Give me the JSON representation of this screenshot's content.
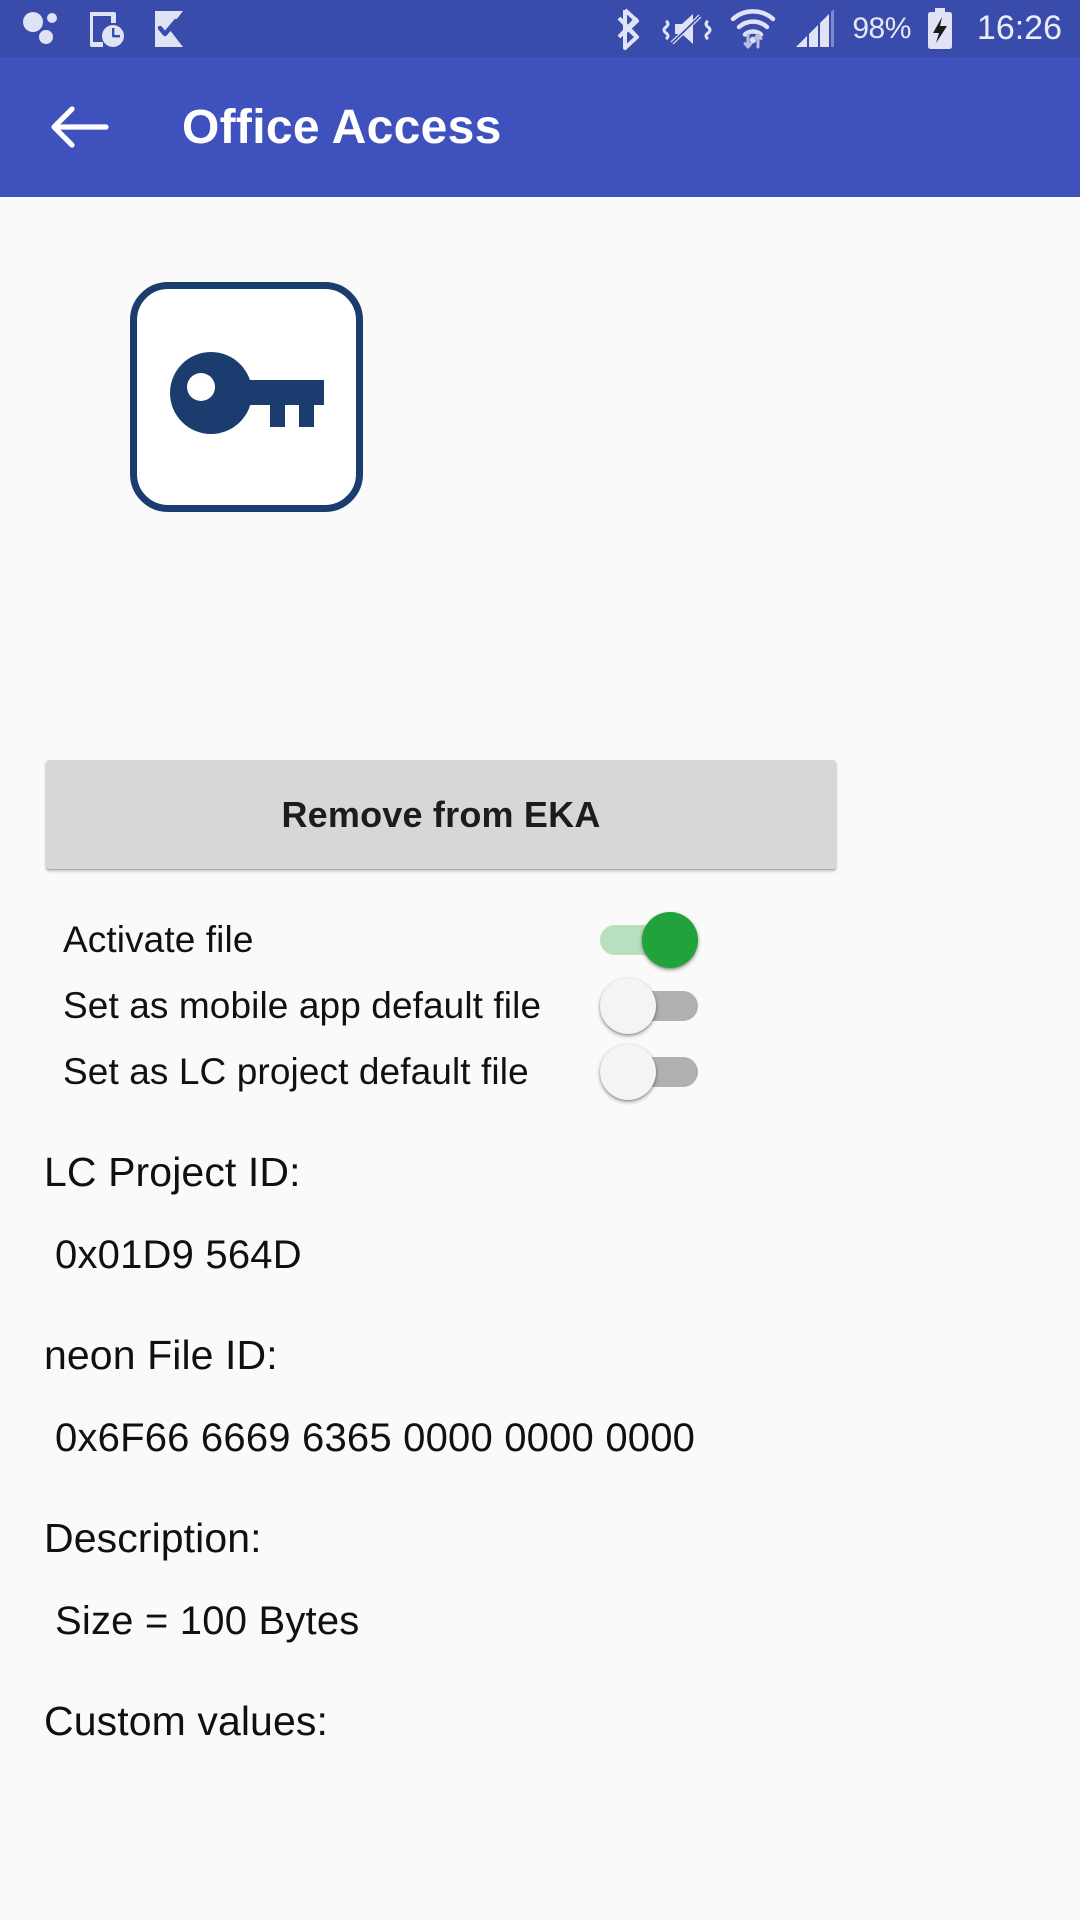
{
  "status_bar": {
    "background_color": "#3a4cab",
    "left_icons": [
      "bubbles-dots-icon",
      "tablet-clock-icon",
      "flag-check-icon"
    ],
    "right_icons": [
      "bluetooth-icon",
      "vibrate-mute-icon",
      "wifi-transfer-icon",
      "cellular-signal-icon",
      "battery-charging-icon"
    ],
    "battery_percent": "98%",
    "clock": "16:26"
  },
  "app_bar": {
    "background_color": "#3f51bd",
    "back_icon": "arrow-left-icon",
    "title": "Office Access"
  },
  "key_card": {
    "icon": "key-icon",
    "border_color": "#1b3c6e",
    "fill_color": "#1b3c6e"
  },
  "remove_button": {
    "label": "Remove from EKA",
    "background_color": "#d6d7d7"
  },
  "toggles": [
    {
      "label": "Activate file",
      "state": "on",
      "accent_color": "#22a23a"
    },
    {
      "label": "Set as mobile app default file",
      "state": "off",
      "accent_color": "#b0b0b0"
    },
    {
      "label": "Set as LC project default file",
      "state": "off",
      "accent_color": "#b0b0b0"
    }
  ],
  "info": {
    "lc_project_id_label": "LC Project ID:",
    "lc_project_id_value": "0x01D9 564D",
    "neon_file_id_label": "neon File ID:",
    "neon_file_id_value": "0x6F66 6669 6365 0000 0000 0000",
    "description_label": "Description:",
    "description_value": "Size = 100 Bytes",
    "custom_values_label": "Custom values:"
  }
}
